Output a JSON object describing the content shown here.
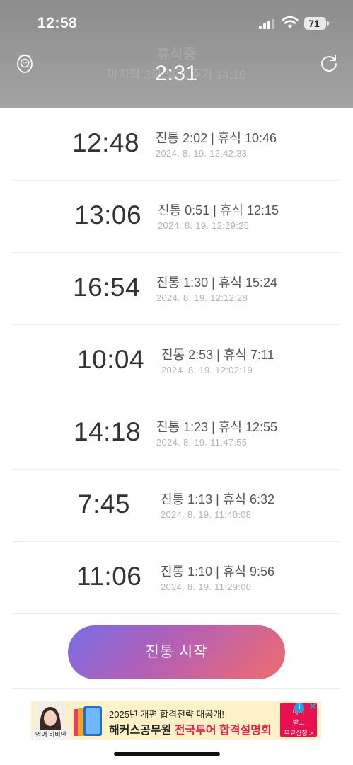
{
  "status_bar": {
    "time": "12:58",
    "battery": "71"
  },
  "header": {
    "status_title": "휴식중",
    "status_subtitle": "마지막 3회 평균 주기 14:16",
    "timer": "2:31",
    "baby_icon": "baby-face-icon",
    "reset_icon": "refresh-icon"
  },
  "contractions": [
    {
      "interval": "12:48",
      "detail": "진통 2:02 | 휴식 10:46",
      "datetime": "2024. 8. 19. 12:42:33"
    },
    {
      "interval": "13:06",
      "detail": "진통 0:51 | 휴식 12:15",
      "datetime": "2024. 8. 19. 12:29:25"
    },
    {
      "interval": "16:54",
      "detail": "진통 1:30 | 휴식 15:24",
      "datetime": "2024. 8. 19. 12:12:28"
    },
    {
      "interval": "10:04",
      "detail": "진통 2:53 | 휴식 7:11",
      "datetime": "2024. 8. 19. 12:02:19"
    },
    {
      "interval": "14:18",
      "detail": "진통 1:23 | 휴식 12:55",
      "datetime": "2024. 8. 19. 11:47:55"
    },
    {
      "interval": "7:45",
      "detail": "진통 1:13 | 휴식 6:32",
      "datetime": "2024. 8. 19. 11:40:08"
    },
    {
      "interval": "11:06",
      "detail": "진통 1:10 | 휴식 9:56",
      "datetime": "2024. 8. 19. 11:29:00"
    }
  ],
  "start_button": {
    "label": "진통 시작"
  },
  "ad": {
    "person_label": "영어 비비안",
    "line1": "2025년 개편 합격전략 대공개!",
    "line2_a": "해커스공무원 ",
    "line2_b": "전국투어 합격설명회",
    "cta_1": "아이",
    "cta_2": "받고",
    "cta_3": "무료신청 >",
    "info": "i",
    "close": "✕"
  },
  "colors": {
    "header_bg": "#9a9a9a",
    "button_start": "#7a6ee6",
    "button_end": "#f06c6c",
    "ad_accent": "#e81d47"
  }
}
